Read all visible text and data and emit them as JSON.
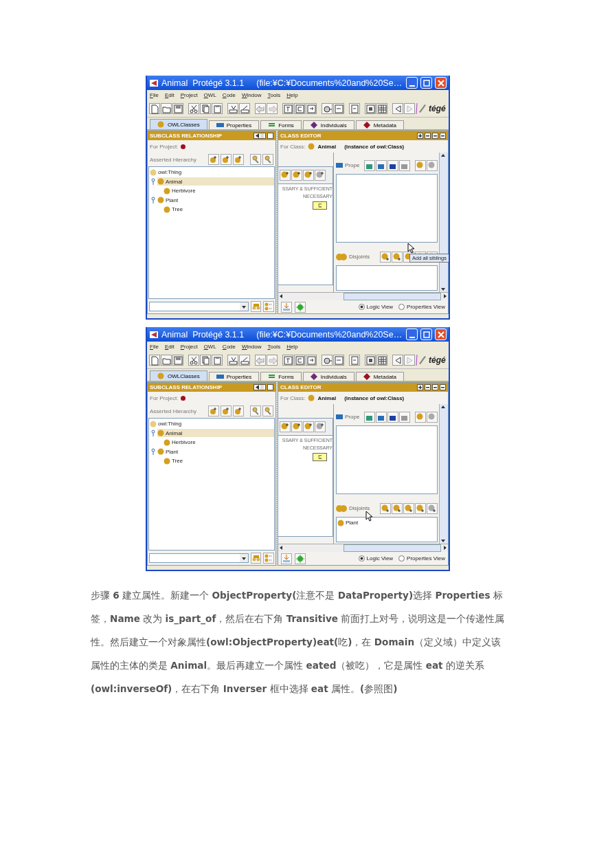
{
  "screenshots": [
    {
      "title_name": "Animal  Protégé 3.1.1",
      "title_path": "(file:¥C:¥Documents%20and%20Se…",
      "menu": [
        "File",
        "Edit",
        "Project",
        "OWL",
        "Code",
        "Window",
        "Tools",
        "Help"
      ],
      "logo_text": "tégé",
      "tabs": [
        {
          "label": "OWLClasses",
          "kind": "class",
          "selected": true
        },
        {
          "label": "Properties",
          "kind": "property",
          "selected": false
        },
        {
          "label": "Forms",
          "kind": "form",
          "selected": false
        },
        {
          "label": "Individuals",
          "kind": "individual",
          "selected": false
        },
        {
          "label": "Metadata",
          "kind": "metadata",
          "selected": false
        }
      ],
      "left_panel": {
        "header": "SUBCLASS RELATIONSHIP",
        "for_project": "For Project:",
        "hierarchy_label": "Asserted Hierarchy",
        "tree": [
          {
            "label": "owl:Thing",
            "kind": "root",
            "selected": false,
            "children": [
              {
                "label": "Animal",
                "kind": "class",
                "selected": true,
                "expanded": true,
                "children": [
                  {
                    "label": "Herbivore",
                    "kind": "class",
                    "selected": false
                  }
                ]
              },
              {
                "label": "Plant",
                "kind": "class",
                "selected": false,
                "expanded": true,
                "children": [
                  {
                    "label": "Tree",
                    "kind": "class",
                    "selected": false
                  }
                ]
              }
            ]
          }
        ]
      },
      "class_editor": {
        "header": "CLASS EDITOR",
        "for_class": "For Class:",
        "class_name": "Animal",
        "instance_text": "(instance of owl:Class)",
        "sufficient_label": "SSARY & SUFFICIENT",
        "necessary_label": "NECESSARY",
        "subclass_symbol": "⊑",
        "properties_label": "Prope",
        "disjoints_label": "Disjoints",
        "tooltip": "Add all siblings",
        "radios": [
          {
            "label": "Logic View",
            "selected": true
          },
          {
            "label": "Properties View",
            "selected": false
          }
        ]
      }
    },
    {
      "title_name": "Animal  Protégé 3.1.1",
      "title_path": "(file:¥C:¥Documents%20and%20Se…",
      "menu": [
        "File",
        "Edit",
        "Project",
        "OWL",
        "Code",
        "Window",
        "Tools",
        "Help"
      ],
      "logo_text": "tégé",
      "tabs": [
        {
          "label": "OWLClasses",
          "kind": "class",
          "selected": true
        },
        {
          "label": "Properties",
          "kind": "property",
          "selected": false
        },
        {
          "label": "Forms",
          "kind": "form",
          "selected": false
        },
        {
          "label": "Individuals",
          "kind": "individual",
          "selected": false
        },
        {
          "label": "Metadata",
          "kind": "metadata",
          "selected": false
        }
      ],
      "left_panel": {
        "header": "SUBCLASS RELATIONSHIP",
        "for_project": "For Project:",
        "hierarchy_label": "Asserted Hierarchy",
        "tree": [
          {
            "label": "owl:Thing",
            "kind": "root",
            "selected": false,
            "children": [
              {
                "label": "Animal",
                "kind": "class",
                "selected": true,
                "expanded": true,
                "children": [
                  {
                    "label": "Herbivore",
                    "kind": "class",
                    "selected": false
                  }
                ]
              },
              {
                "label": "Plant",
                "kind": "class",
                "selected": false,
                "expanded": true,
                "children": [
                  {
                    "label": "Tree",
                    "kind": "class",
                    "selected": false
                  }
                ]
              }
            ]
          }
        ]
      },
      "class_editor": {
        "header": "CLASS EDITOR",
        "for_class": "For Class:",
        "class_name": "Animal",
        "instance_text": "(instance of owl:Class)",
        "sufficient_label": "SSARY & SUFFICIENT",
        "necessary_label": "NECESSARY",
        "subclass_symbol": "⊑",
        "properties_label": "Prope",
        "disjoints_label": "Disjoints",
        "disjoints": [
          {
            "label": "Plant"
          }
        ],
        "radios": [
          {
            "label": "Logic View",
            "selected": true
          },
          {
            "label": "Properties View",
            "selected": false
          }
        ]
      }
    }
  ],
  "paragraph": "步骤 **6**  建立属性。新建一个 **ObjectProperty(**注意不是 **DataProperty)**选择 **Properties** 标签，**Name** 改为 **is_part_of**，然后在右下角 **Transitive** 前面打上对号，说明这是一个传递性属性。然后建立一个对象属性**(owl:ObjectProperty)eat(**吃**)**，在 **Domain**（定义域）中定义该属性的主体的类是 **Animal**。最后再建立一个属性 **eated**（被吃），它是属性 **eat** 的逆关系 **(owl:inverseOf)**，在右下角 **Inverser** 框中选择 **eat** 属性。**(**参照图**)**"
}
